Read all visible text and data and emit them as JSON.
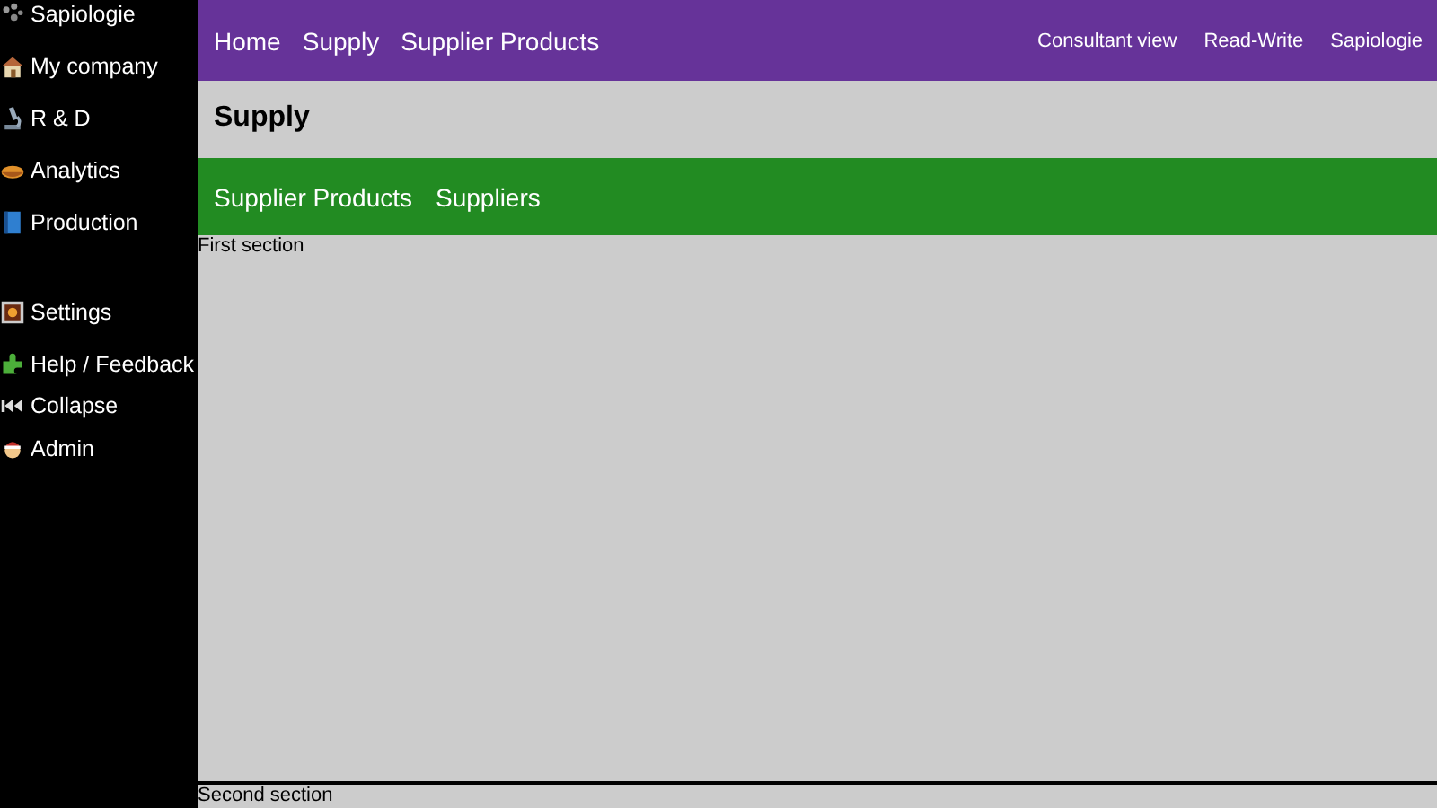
{
  "sidebar": {
    "groups": [
      {
        "items": [
          {
            "label": "Sapiologie",
            "kind": "link"
          },
          {
            "label": "My company",
            "kind": "link"
          },
          {
            "label": "R & D",
            "kind": "link"
          },
          {
            "label": "Analytics",
            "kind": "link"
          },
          {
            "label": "Production",
            "kind": "link"
          }
        ]
      },
      {
        "items": [
          {
            "label": "Settings",
            "kind": "link"
          },
          {
            "label": "Help / Feedback",
            "kind": "link"
          },
          {
            "label": "Collapse",
            "kind": "toggle"
          },
          {
            "label": "Admin",
            "kind": "link"
          }
        ]
      }
    ]
  },
  "top_bar": {
    "breadcrumbs": [
      "Home",
      "Supply",
      "Supplier Products"
    ],
    "right_links": [
      "Consultant view",
      "Read-Write",
      "Sapiologie"
    ]
  },
  "page_title": "Supply",
  "sub_nav": [
    "Supplier Products",
    "Suppliers"
  ],
  "sections": [
    "First section",
    "Second section"
  ]
}
